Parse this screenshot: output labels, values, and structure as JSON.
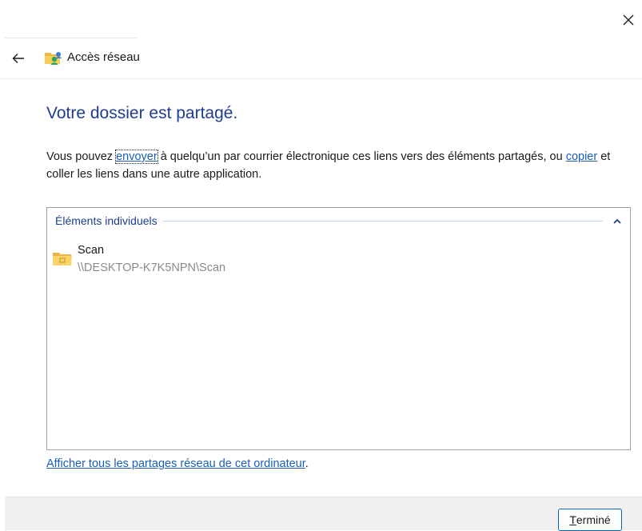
{
  "window": {
    "title": "Accès réseau"
  },
  "content": {
    "heading": "Votre dossier est partagé.",
    "description_part1": "Vous pouvez ",
    "email_link": "envoyer",
    "description_part2": " à quelqu’un par courrier électronique ces liens vers des éléments partagés, ou ",
    "copy_link": "copier",
    "description_part3": " et coller les liens dans une autre application."
  },
  "group": {
    "label": "Éléments individuels",
    "items": [
      {
        "name": "Scan",
        "path": "\\\\DESKTOP-K7K5NPN\\Scan",
        "icon": "shared-folder-icon"
      }
    ]
  },
  "footer": {
    "show_all_link": "Afficher tous les partages réseau de cet ordinateur",
    "show_all_suffix": ".",
    "done_mnemonic": "T",
    "done_rest": "erminé"
  },
  "icons": {
    "close": "close-icon",
    "back": "back-arrow-icon",
    "title": "network-access-icon",
    "collapse": "chevron-up-icon"
  },
  "colors": {
    "heading": "#1d3d8f",
    "link": "#1a5fb4",
    "path": "#8a8a8a",
    "footer_bg": "#f0f0f0",
    "button_border": "#0067c0"
  }
}
